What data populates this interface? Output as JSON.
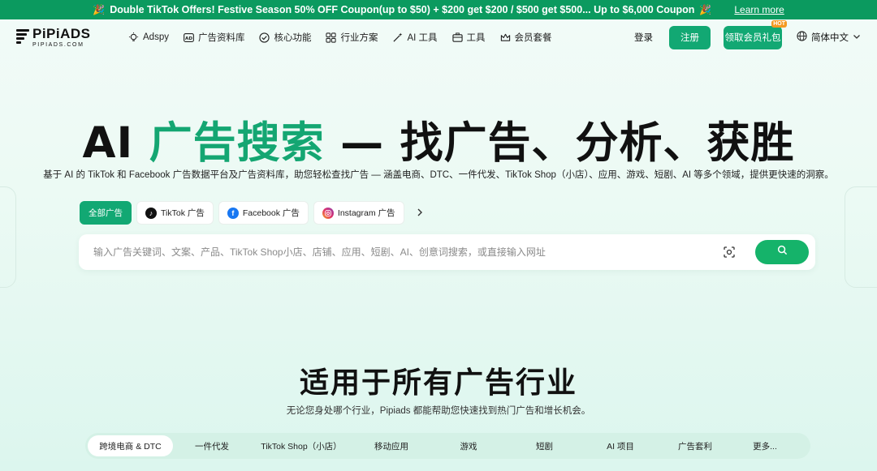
{
  "banner": {
    "text": "Double TikTok Offers! Festive Season 50% OFF Coupon(up to $50) + $200 get $200 / $500 get $500... Up to $6,000 Coupon",
    "learn_more": "Learn more"
  },
  "logo": {
    "name": "PiPiADS",
    "domain": "PIPIADS.COM"
  },
  "nav": {
    "items": [
      {
        "label": "Adspy",
        "icon": "bulb-icon"
      },
      {
        "label": "广告资料库",
        "icon": "ad-icon"
      },
      {
        "label": "核心功能",
        "icon": "check-circle-icon"
      },
      {
        "label": "行业方案",
        "icon": "grid-icon"
      },
      {
        "label": "AI 工具",
        "icon": "magic-wand-icon"
      },
      {
        "label": "工具",
        "icon": "toolbox-icon"
      },
      {
        "label": "会员套餐",
        "icon": "crown-icon"
      }
    ],
    "login": "登录",
    "register": "注册",
    "gift": "领取会员礼包",
    "gift_badge": "HOT",
    "language": "简体中文"
  },
  "hero": {
    "title_pre": "AI ",
    "title_highlight": "广告搜索",
    "title_post": " — 找广告、分析、获胜",
    "subtitle": "基于 AI 的 TikTok 和 Facebook 广告数据平台及广告资料库，助您轻松查找广告 — 涵盖电商、DTC、一件代发、TikTok Shop（小店）、应用、游戏、短剧、AI 等多个领域，提供更快速的洞察。"
  },
  "platform_tabs": [
    {
      "label": "全部广告",
      "active": true
    },
    {
      "label": "TikTok 广告",
      "icon": "tiktok-icon"
    },
    {
      "label": "Facebook 广告",
      "icon": "facebook-icon"
    },
    {
      "label": "Instagram 广告",
      "icon": "instagram-icon"
    }
  ],
  "search": {
    "placeholder": "输入广告关键词、文案、产品、TikTok Shop小店、店铺、应用、短剧、AI、创意词搜索，或直接输入网址"
  },
  "industries": {
    "title": "适用于所有广告行业",
    "subtitle": "无论您身处哪个行业，Pipiads 都能帮助您快速找到热门广告和增长机会。",
    "tabs": [
      "跨境电商 & DTC",
      "一件代发",
      "TikTok Shop（小店）",
      "移动应用",
      "游戏",
      "短剧",
      "AI 项目",
      "广告套利",
      "更多..."
    ]
  },
  "colors": {
    "brand": "#12a873",
    "banner": "#0b9a5f"
  }
}
